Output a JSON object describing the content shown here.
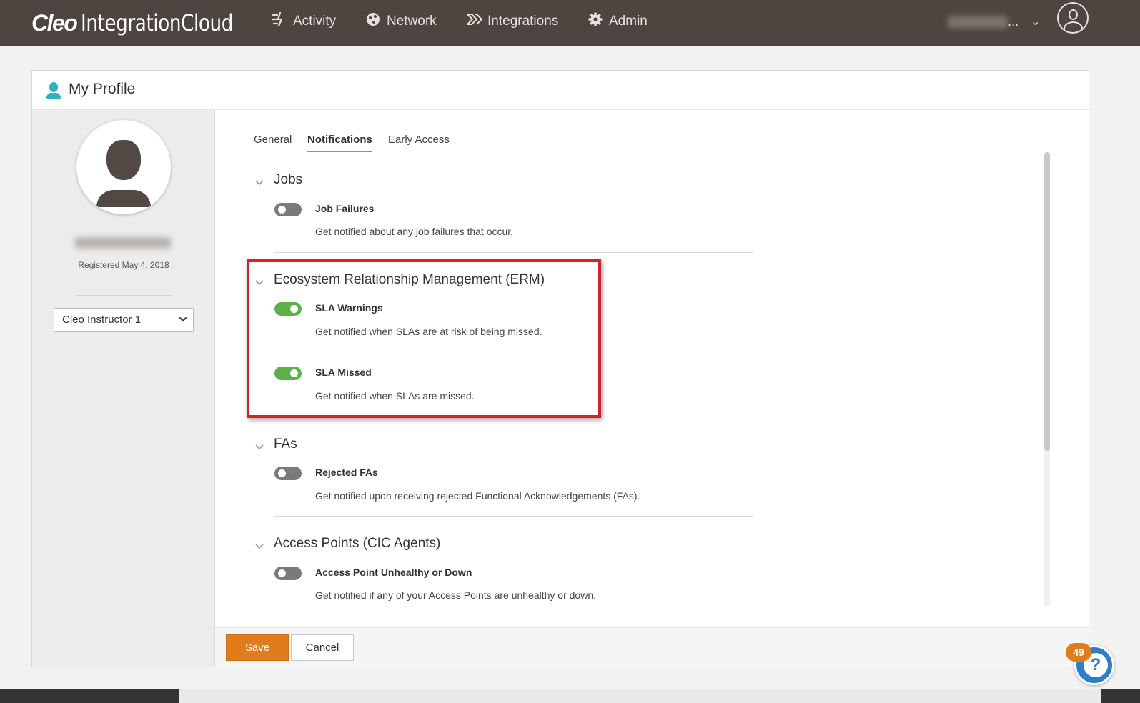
{
  "brand": {
    "strong": "Cleo",
    "light": "IntegrationCloud"
  },
  "nav": [
    {
      "label": "Activity",
      "icon": "activity-icon"
    },
    {
      "label": "Network",
      "icon": "network-icon"
    },
    {
      "label": "Integrations",
      "icon": "integrations-icon"
    },
    {
      "label": "Admin",
      "icon": "gear-icon"
    }
  ],
  "user_menu": {
    "ellipsis": "...",
    "caret": "⌄"
  },
  "panel": {
    "title": "My Profile"
  },
  "sidebar": {
    "registered": "Registered May 4, 2018",
    "select_value": "Cleo Instructor 1"
  },
  "tabs": [
    {
      "label": "General",
      "active": false
    },
    {
      "label": "Notifications",
      "active": true
    },
    {
      "label": "Early Access",
      "active": false
    }
  ],
  "sections": {
    "jobs": {
      "title": "Jobs",
      "items": [
        {
          "title": "Job Failures",
          "desc": "Get notified about any job failures that occur.",
          "enabled": false
        }
      ]
    },
    "erm": {
      "title": "Ecosystem Relationship Management (ERM)",
      "items": [
        {
          "title": "SLA Warnings",
          "desc": "Get notified when SLAs are at risk of being missed.",
          "enabled": true
        },
        {
          "title": "SLA Missed",
          "desc": "Get notified when SLAs are missed.",
          "enabled": true
        }
      ]
    },
    "fas": {
      "title": "FAs",
      "items": [
        {
          "title": "Rejected FAs",
          "desc": "Get notified upon receiving rejected Functional Acknowledgements (FAs).",
          "enabled": false
        }
      ]
    },
    "access": {
      "title": "Access Points (CIC Agents)",
      "items": [
        {
          "title": "Access Point Unhealthy or Down",
          "desc": "Get notified if any of your Access Points are unhealthy or down.",
          "enabled": false
        }
      ]
    }
  },
  "footer": {
    "save": "Save",
    "cancel": "Cancel"
  },
  "help": {
    "badge": "49",
    "glyph": "?"
  },
  "colors": {
    "topbar": "#4e4540",
    "accent": "#e07c1c",
    "toggle_on": "#5eb04a",
    "highlight": "#d0232a",
    "profile_icon": "#2cb5c0"
  }
}
